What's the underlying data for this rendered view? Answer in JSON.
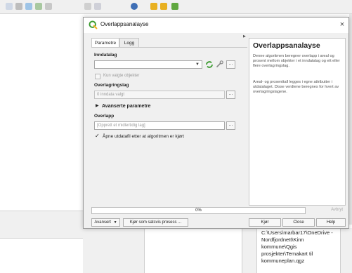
{
  "dialog": {
    "title": "Overlappsanalayse",
    "close_label": "×"
  },
  "tabs": [
    {
      "label": "Parametre",
      "active": true
    },
    {
      "label": "Logg",
      "active": false
    }
  ],
  "params": {
    "input_label": "Inndatalag",
    "input_value": "",
    "selected_only_label": "Kun valgte objekter",
    "overlay_label": "Overlagringslag",
    "overlay_value": "0 inndata valgt",
    "advanced_label": "Avanserte parametre",
    "advanced_arrow": "▶",
    "overlap_label": "Overlapp",
    "overlap_placeholder": "[Opprett et midlertidig lag]",
    "open_output_label": "Åpne utdatafil etter at algoritmen er kjørt",
    "open_output_checked": "✓"
  },
  "help": {
    "title": "Overlappsanalayse",
    "para1": "Denne algoritmen beregner overlapp i areal og prosent mellom objekter i et inndatalag og ett eller flere overlagringslag.",
    "para2": "Areal- og prosenttall legges i egne attributter i utdatalaget. Disse verdiene beregnes for hvert av overlagringslagene."
  },
  "progress": {
    "text": "0%",
    "value": 0
  },
  "buttons": {
    "cancel": "Avbryt",
    "advanced": "Avansert",
    "advanced_arrow": "▼",
    "batch": "Kjør som satsvis prosess ...",
    "run": "Kjør",
    "close": "Close",
    "help": "Help"
  },
  "background": {
    "path_text": "C:\\Users\\marbar17\\OneDrive - Nordfjordnett\\Kinn kommune\\Qgis prosjekter\\Temakart til kommuneplan.qgz"
  },
  "colors": {
    "accent_green": "#3a9a2f",
    "window_bg": "#f0f0f0"
  }
}
